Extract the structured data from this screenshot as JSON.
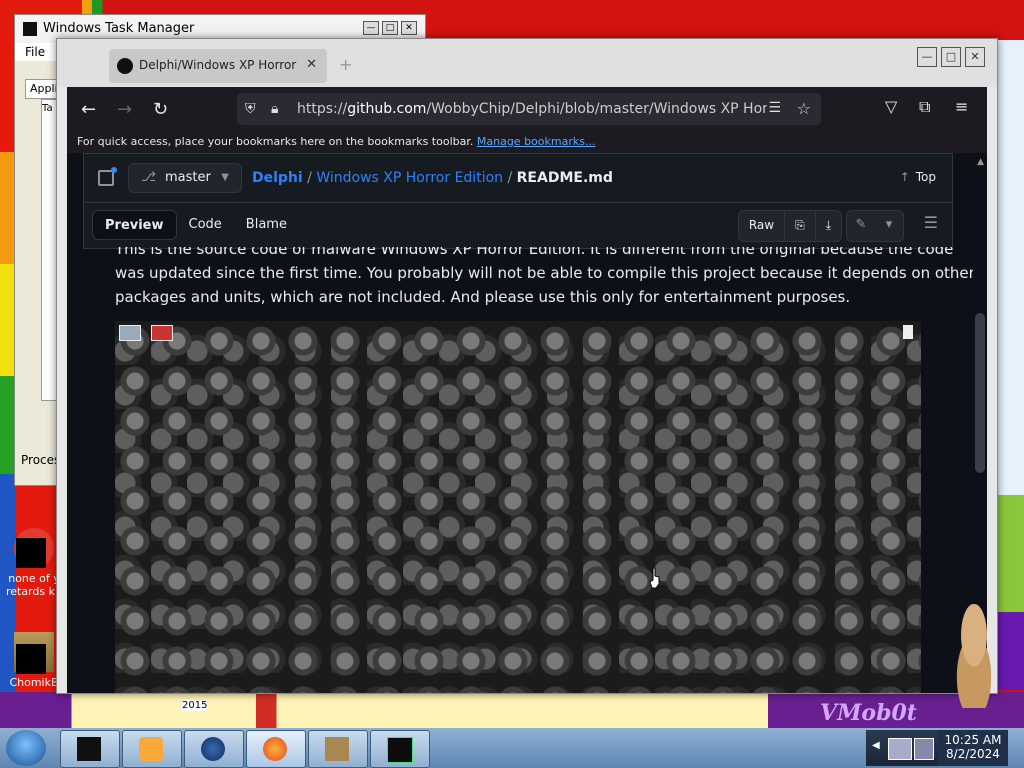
{
  "task_manager": {
    "title": "Windows Task Manager",
    "menu_label": "File",
    "tab_label": "Applic",
    "tab2_label": "Ta",
    "status_label": "Proces",
    "buttons": [
      "—",
      "□",
      "✕"
    ]
  },
  "desktop": {
    "icon1_label": "none of y retards kn",
    "icon2_label": "ChomikB",
    "bottom_year": "2015",
    "logo_text": "VMob0t"
  },
  "browser": {
    "tab_label": "Delphi/Windows XP Horror Edit",
    "tab_close": "✕",
    "new_tab": "+",
    "window_buttons": [
      "—",
      "□",
      "✕"
    ],
    "url_prefix": "https://",
    "url_host": "github.com",
    "url_path": "/WobbyChip/Delphi/blob/master/Windows XP Horror Edition/README.md",
    "bookmarks_text": "For quick access, place your bookmarks here on the bookmarks toolbar.",
    "bookmarks_link": "Manage bookmarks..."
  },
  "github": {
    "branch": "master",
    "breadcrumb": {
      "repo": "Delphi",
      "sep": "/",
      "folder": "Windows XP Horror Edition",
      "file": "README.md"
    },
    "top_label": "Top",
    "views": [
      "Preview",
      "Code",
      "Blame"
    ],
    "raw_label": "Raw",
    "readme_partial": "This is the source code of malware Windows XP Horror Edition. It is different from the original because the code",
    "readme_line2": "was updated since the first time. You probably will not be able to compile this project because it depends on other",
    "readme_line3": "packages and units, which are not included. And please use this only for entertainment purposes."
  },
  "taskbar": {
    "time": "10:25 AM",
    "date": "8/2/2024"
  },
  "colors": {
    "github_bg": "#0d1117",
    "link": "#2f81f7",
    "firefox_toolbar": "#1c1b22"
  }
}
